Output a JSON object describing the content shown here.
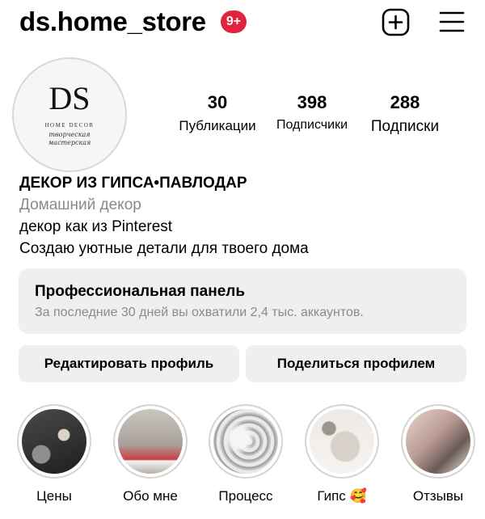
{
  "header": {
    "username": "ds.home_store",
    "notification_badge": "9+",
    "add_icon": "plus-square-icon",
    "menu_icon": "hamburger-menu-icon"
  },
  "avatar": {
    "logo_letters": "DS",
    "logo_subtitle": "HOME DECOR",
    "logo_tagline_1": "творческая",
    "logo_tagline_2": "мастерская"
  },
  "stats": {
    "posts": {
      "value": "30",
      "label": "Публикации"
    },
    "followers": {
      "value": "398",
      "label": "Подписчики"
    },
    "following": {
      "value": "288",
      "label": "Подписки"
    }
  },
  "bio": {
    "name": "ДЕКОР ИЗ ГИПСА•ПАВЛОДАР",
    "category": "Домашний декор",
    "line1": "декор как из Pinterest",
    "line2": "Создаю уютные детали для твоего дома"
  },
  "pro_panel": {
    "title": "Профессиональная панель",
    "subtitle": "За последние 30 дней вы охватили 2,4 тыс. аккаунтов."
  },
  "buttons": {
    "edit": "Редактировать профиль",
    "share": "Поделиться профилем"
  },
  "highlights": [
    {
      "label": "Цены"
    },
    {
      "label": "Обо мне"
    },
    {
      "label": "Процесс"
    },
    {
      "label": "Гипс 🥰"
    },
    {
      "label": "Отзывы"
    }
  ],
  "colors": {
    "badge": "#e0243f",
    "panel_bg": "#efefef",
    "secondary_text": "#8a8a8a"
  }
}
